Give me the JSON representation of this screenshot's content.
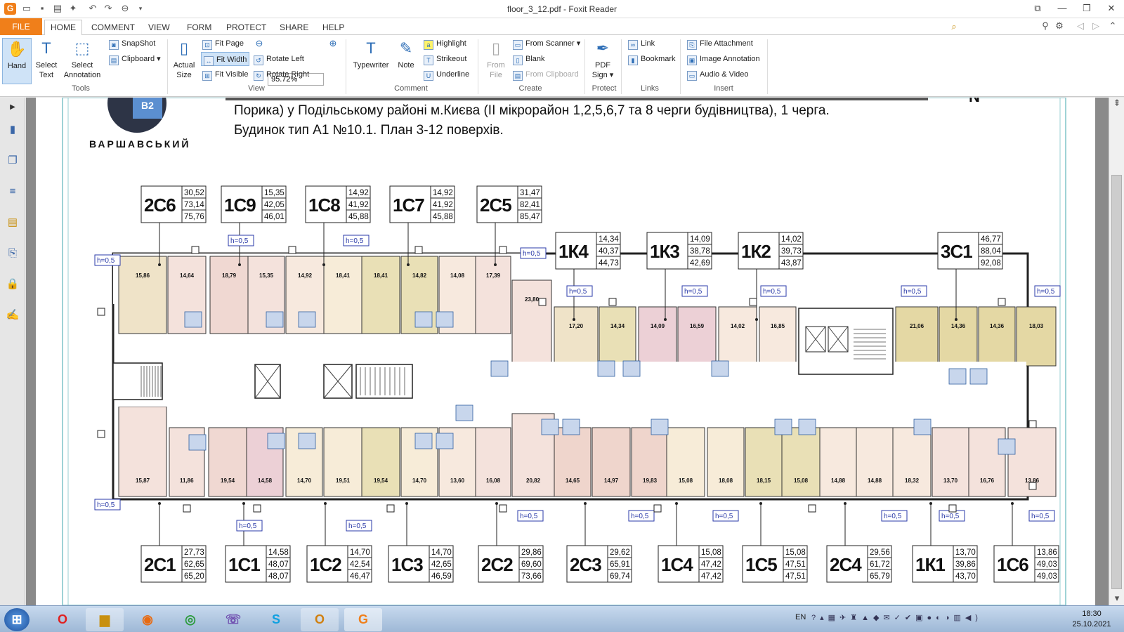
{
  "window": {
    "title": "floor_3_12.pdf - Foxit Reader",
    "logo": "G"
  },
  "tabs": [
    "FILE",
    "HOME",
    "COMMENT",
    "VIEW",
    "FORM",
    "PROTECT",
    "SHARE",
    "HELP"
  ],
  "active_tab": "HOME",
  "find_placeholder": "Find",
  "ribbon": {
    "tools": {
      "hand": "Hand",
      "select_text": "Select Text",
      "select_annotation": "Select Annotation",
      "snapshot": "SnapShot",
      "clipboard": "Clipboard",
      "group": "Tools"
    },
    "view": {
      "actual_size": "Actual Size",
      "fit_page": "Fit Page",
      "fit_width": "Fit Width",
      "fit_visible": "Fit Visible",
      "zoom": "95.72%",
      "rotate_left": "Rotate Left",
      "rotate_right": "Rotate Right",
      "group": "View"
    },
    "comment": {
      "typewriter": "Typewriter",
      "note": "Note",
      "highlight": "Highlight",
      "strikeout": "Strikeout",
      "underline": "Underline",
      "group": "Comment"
    },
    "create": {
      "from_file": "From File",
      "from_scanner": "From Scanner",
      "blank": "Blank",
      "from_clipboard": "From Clipboard",
      "group": "Create"
    },
    "protect": {
      "pdf_sign": "PDF Sign",
      "group": "Protect"
    },
    "links": {
      "link": "Link",
      "bookmark": "Bookmark",
      "group": "Links"
    },
    "insert": {
      "file_attachment": "File Attachment",
      "image_annotation": "Image Annotation",
      "audio_video": "Audio & Video",
      "group": "Insert"
    }
  },
  "document": {
    "brand": "ВАРШАВСЬКИЙ",
    "brand_mark": "В2",
    "heading_line1": "Порика) у Подільському районі м.Києва (II мікрорайон 1,2,5,6,7 та 8 черги будівництва), 1 черга.",
    "heading_line2": "Будинок тип А1 №10.1.   План 3-12 поверхів.",
    "north": "N",
    "height_tag": "h=0,5",
    "top_units": [
      {
        "id": "2С6",
        "v": [
          "30,52",
          "73,14",
          "75,76"
        ]
      },
      {
        "id": "1С9",
        "v": [
          "15,35",
          "42,05",
          "46,01"
        ]
      },
      {
        "id": "1С8",
        "v": [
          "14,92",
          "41,92",
          "45,88"
        ]
      },
      {
        "id": "1С7",
        "v": [
          "14,92",
          "41,92",
          "45,88"
        ]
      },
      {
        "id": "2С5",
        "v": [
          "31,47",
          "82,41",
          "85,47"
        ]
      },
      {
        "id": "1К4",
        "v": [
          "14,34",
          "40,37",
          "44,73"
        ]
      },
      {
        "id": "1К3",
        "v": [
          "14,09",
          "38,78",
          "42,69"
        ]
      },
      {
        "id": "1К2",
        "v": [
          "14,02",
          "39,73",
          "43,87"
        ]
      },
      {
        "id": "3С1",
        "v": [
          "46,77",
          "88,04",
          "92,08"
        ]
      }
    ],
    "bottom_units": [
      {
        "id": "2С1",
        "v": [
          "27,73",
          "62,65",
          "65,20"
        ]
      },
      {
        "id": "1С1",
        "v": [
          "14,58",
          "48,07",
          "48,07"
        ]
      },
      {
        "id": "1С2",
        "v": [
          "14,70",
          "42,54",
          "46,47"
        ]
      },
      {
        "id": "1С3",
        "v": [
          "14,70",
          "42,65",
          "46,59"
        ]
      },
      {
        "id": "2С2",
        "v": [
          "29,86",
          "69,60",
          "73,66"
        ]
      },
      {
        "id": "2С3",
        "v": [
          "29,62",
          "65,91",
          "69,74"
        ]
      },
      {
        "id": "1С4",
        "v": [
          "15,08",
          "47,42",
          "47,42"
        ]
      },
      {
        "id": "1С5",
        "v": [
          "15,08",
          "47,51",
          "47,51"
        ]
      },
      {
        "id": "2С4",
        "v": [
          "29,56",
          "61,72",
          "65,79"
        ]
      },
      {
        "id": "1К1",
        "v": [
          "13,70",
          "39,86",
          "43,70"
        ]
      },
      {
        "id": "1С6",
        "v": [
          "13,86",
          "49,03",
          "49,03"
        ]
      }
    ],
    "room_areas_top": [
      "15,86",
      "14,64",
      "18,79",
      "15,35",
      "14,92",
      "18,41",
      "18,41",
      "14,82",
      "14,08",
      "17,39",
      "23,80",
      "17,20",
      "14,34",
      "14,09",
      "16,59",
      "14,02",
      "16,85",
      "21,06",
      "14,36",
      "14,36",
      "18,03"
    ],
    "room_areas_bottom": [
      "15,87",
      "11,86",
      "19,54",
      "14,58",
      "14,70",
      "19,51",
      "19,54",
      "14,70",
      "13,60",
      "16,08",
      "20,82",
      "14,65",
      "14,97",
      "19,83",
      "15,08",
      "18,08",
      "18,15",
      "15,08",
      "14,88",
      "14,88",
      "18,32",
      "13,70",
      "16,76",
      "13,86"
    ]
  },
  "taskbar": {
    "time": "18:30",
    "date": "25.10.2021",
    "lang": "EN"
  }
}
